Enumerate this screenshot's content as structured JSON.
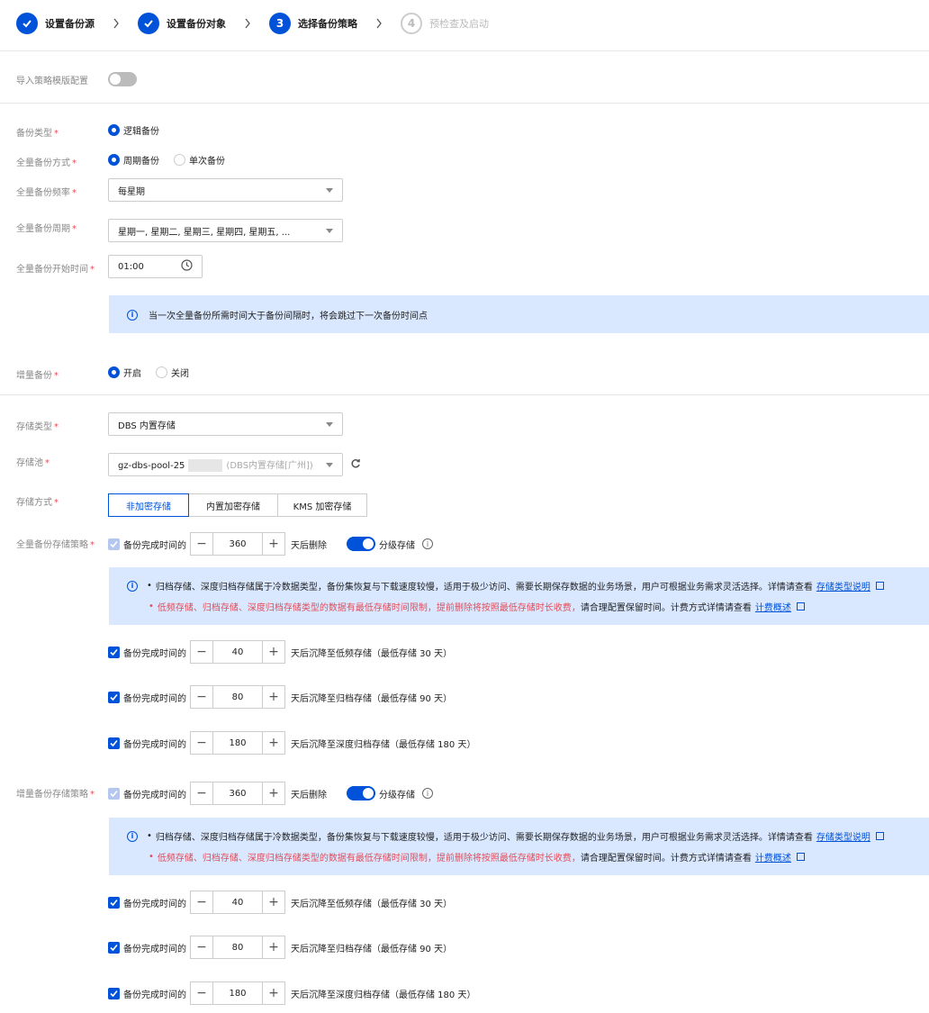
{
  "steps": [
    {
      "label": "设置备份源",
      "state": "done",
      "number": ""
    },
    {
      "label": "设置备份对象",
      "state": "done",
      "number": ""
    },
    {
      "label": "选择备份策略",
      "state": "active",
      "number": "3"
    },
    {
      "label": "预检查及启动",
      "state": "todo",
      "number": "4"
    }
  ],
  "import_template": {
    "label": "导入策略模版配置",
    "on": false
  },
  "backup_type": {
    "label": "备份类型",
    "options": [
      "逻辑备份"
    ]
  },
  "full_backup_mode": {
    "label": "全量备份方式",
    "options": [
      "周期备份",
      "单次备份"
    ],
    "selected": 0
  },
  "full_backup_freq": {
    "label": "全量备份频率",
    "value": "每星期"
  },
  "full_backup_period": {
    "label": "全量备份周期",
    "value": "星期一, 星期二, 星期三, 星期四, 星期五, ..."
  },
  "full_backup_start": {
    "label": "全量备份开始时间",
    "value": "01:00"
  },
  "notice1": "当一次全量备份所需时间大于备份间隔时，将会跳过下一次备份时间点",
  "incremental": {
    "label": "增量备份",
    "options": [
      "开启",
      "关闭"
    ],
    "selected": 0
  },
  "storage_type": {
    "label": "存储类型",
    "value": "DBS 内置存储"
  },
  "storage_pool": {
    "label": "存储池",
    "value": "gz-dbs-pool-25",
    "suffix": "(DBS内置存储[广州])"
  },
  "storage_mode": {
    "label": "存储方式",
    "options": [
      "非加密存储",
      "内置加密存储",
      "KMS 加密存储"
    ],
    "selected": 0
  },
  "policy_common": {
    "prefix": "备份完成时间的",
    "delete_suffix": "天后删除",
    "tier_label": "分级存储",
    "info_line1": "归档存储、深度归档存储属于冷数据类型，备份集恢复与下载速度较慢，适用于极少访问、需要长期保存数据的业务场景，用户可根据业务需求灵活选择。详情请查看",
    "info_link1": "存储类型说明",
    "info_line2_red": "低频存储、归档存储、深度归档存储类型的数据有最低存储时间限制，提前删除将按照最低存储时长收费，",
    "info_line2_dark": "请合理配置保留时间。计费方式详情请查看",
    "info_link2": "计费概述"
  },
  "full_policy": {
    "label": "全量备份存储策略",
    "delete_days": "360",
    "tiers": [
      {
        "days": "40",
        "suffix": "天后沉降至低频存储（最低存储 30 天）"
      },
      {
        "days": "80",
        "suffix": "天后沉降至归档存储（最低存储 90 天）"
      },
      {
        "days": "180",
        "suffix": "天后沉降至深度归档存储（最低存储 180 天）"
      }
    ]
  },
  "inc_policy": {
    "label": "增量备份存储策略",
    "delete_days": "360",
    "tiers": [
      {
        "days": "40",
        "suffix": "天后沉降至低频存储（最低存储 30 天）"
      },
      {
        "days": "80",
        "suffix": "天后沉降至归档存储（最低存储 90 天）"
      },
      {
        "days": "180",
        "suffix": "天后沉降至深度归档存储（最低存储 180 天）"
      }
    ]
  },
  "colors": {
    "primary": "#0052d9",
    "danger": "#e34d59",
    "alert_bg": "#d9e8ff"
  }
}
